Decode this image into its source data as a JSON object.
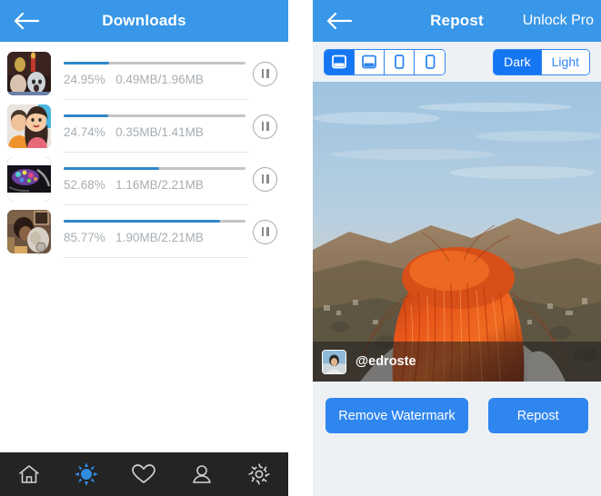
{
  "left": {
    "navbar": {
      "back_icon": "back-arrow-icon",
      "title": "Downloads"
    },
    "downloads": [
      {
        "percent_label": "24.95%",
        "size_label": "0.49MB/1.96MB",
        "percent": 24.95,
        "pause_icon": "pause-icon"
      },
      {
        "percent_label": "24.74%",
        "size_label": "0.35MB/1.41MB",
        "percent": 24.74,
        "pause_icon": "pause-icon"
      },
      {
        "percent_label": "52.68%",
        "size_label": "1.16MB/2.21MB",
        "percent": 52.68,
        "pause_icon": "pause-icon"
      },
      {
        "percent_label": "85.77%",
        "size_label": "1.90MB/2.21MB",
        "percent": 85.77,
        "pause_icon": "pause-icon"
      }
    ],
    "tabbar": [
      {
        "icon": "home-icon",
        "active": false
      },
      {
        "icon": "sun-icon",
        "active": true
      },
      {
        "icon": "heart-icon",
        "active": false
      },
      {
        "icon": "person-icon",
        "active": false
      },
      {
        "icon": "gear-icon",
        "active": false
      }
    ]
  },
  "right": {
    "navbar": {
      "back_icon": "back-arrow-icon",
      "title": "Repost",
      "action_label": "Unlock Pro"
    },
    "position_segments": [
      {
        "icon": "watermark-bottom-wide-icon",
        "selected": true
      },
      {
        "icon": "watermark-top-wide-icon",
        "selected": false
      },
      {
        "icon": "watermark-left-tall-icon",
        "selected": false
      },
      {
        "icon": "watermark-right-tall-icon",
        "selected": false
      }
    ],
    "theme_segments": [
      {
        "label": "Dark",
        "selected": true
      },
      {
        "label": "Light",
        "selected": false
      }
    ],
    "preview": {
      "watermark_username": "@edroste",
      "avatar_icon": "user-avatar"
    },
    "buttons": [
      {
        "label": "Remove Watermark",
        "name": "remove-watermark-button"
      },
      {
        "label": "Repost",
        "name": "repost-button"
      }
    ]
  },
  "colors": {
    "brand_blue": "#3897e8",
    "button_blue": "#2f86ef",
    "progress_blue": "#2f87c8",
    "tabbar_dark": "#242424",
    "panel_bg": "#eef1f4",
    "muted_text": "#a8aeb3"
  }
}
